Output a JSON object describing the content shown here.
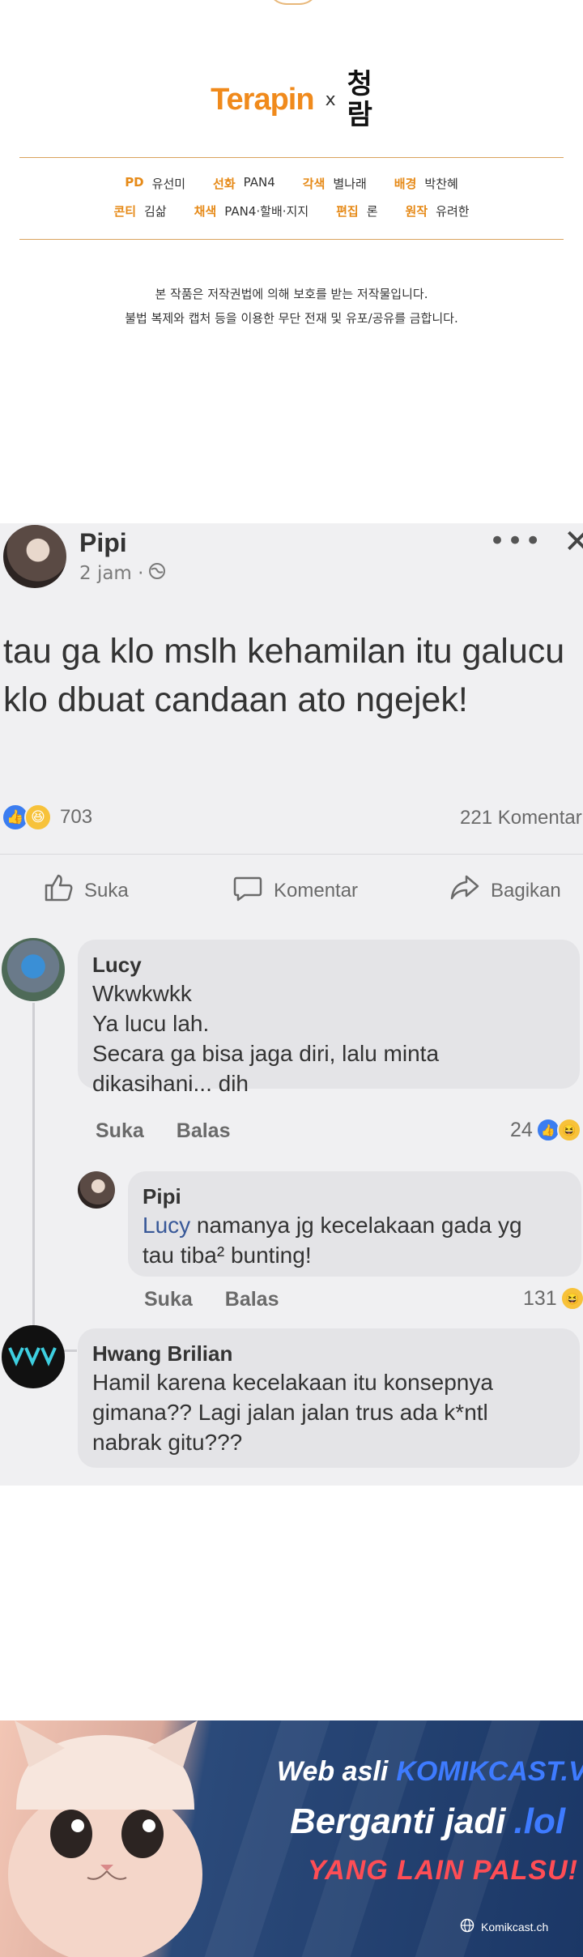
{
  "credits": {
    "logo_terapin": "Terapin",
    "logo_times": "x",
    "logo_partner_top": "청",
    "logo_partner_bottom": "람",
    "row1": [
      {
        "role": "PD",
        "name": "유선미"
      },
      {
        "role": "선화",
        "name": "PAN4"
      },
      {
        "role": "각색",
        "name": "별나래"
      },
      {
        "role": "배경",
        "name": "박찬혜"
      }
    ],
    "row2": [
      {
        "role": "콘티",
        "name": "김삶"
      },
      {
        "role": "채색",
        "name": "PAN4·할배·지지"
      },
      {
        "role": "편집",
        "name": "론"
      },
      {
        "role": "원작",
        "name": "유려한"
      }
    ],
    "notice_line1": "본 작품은 저작권법에 의해 보호를 받는 저작물입니다.",
    "notice_line2": "불법 복제와 캡처 등을 이용한 무단 전재 및 유포/공유를 금합니다.",
    "accent_color": "#f08a1c"
  },
  "post": {
    "author": "Pipi",
    "time": "2 jam ·",
    "body": "tau ga klo mslh kehamilan itu galucu klo dbuat candaan ato ngejek!",
    "reaction_count": "703",
    "comment_count": "221 Komentar",
    "actions": {
      "like": "Suka",
      "comment": "Komentar",
      "share": "Bagikan"
    }
  },
  "comments": [
    {
      "name": "Lucy",
      "lines": [
        "Wkwkwkk",
        "Ya lucu lah.",
        "Secara ga bisa jaga diri, lalu minta",
        "dikasihani... dih"
      ],
      "like_label": "Suka",
      "reply_label": "Balas",
      "likes": "24"
    },
    {
      "name": "Pipi",
      "mention": "Lucy",
      "line1_rest": " namanya jg kecelakaan gada yg",
      "line2": "tau tiba² bunting!",
      "like_label": "Suka",
      "reply_label": "Balas",
      "likes": "131"
    },
    {
      "name": "Hwang Brilian",
      "lines": [
        "Hamil karena kecelakaan itu konsepnya",
        "gimana?? Lagi jalan jalan trus ada k*ntl",
        "nabrak gitu???"
      ]
    }
  ],
  "banner": {
    "line1_a": "Web asli",
    "line1_b": "KOMIKCAST.VIP",
    "line2_a": "Berganti jadi",
    "line2_b": ".lol",
    "line3": "YANG LAIN PALSU!",
    "site": "Komikcast.ch"
  }
}
